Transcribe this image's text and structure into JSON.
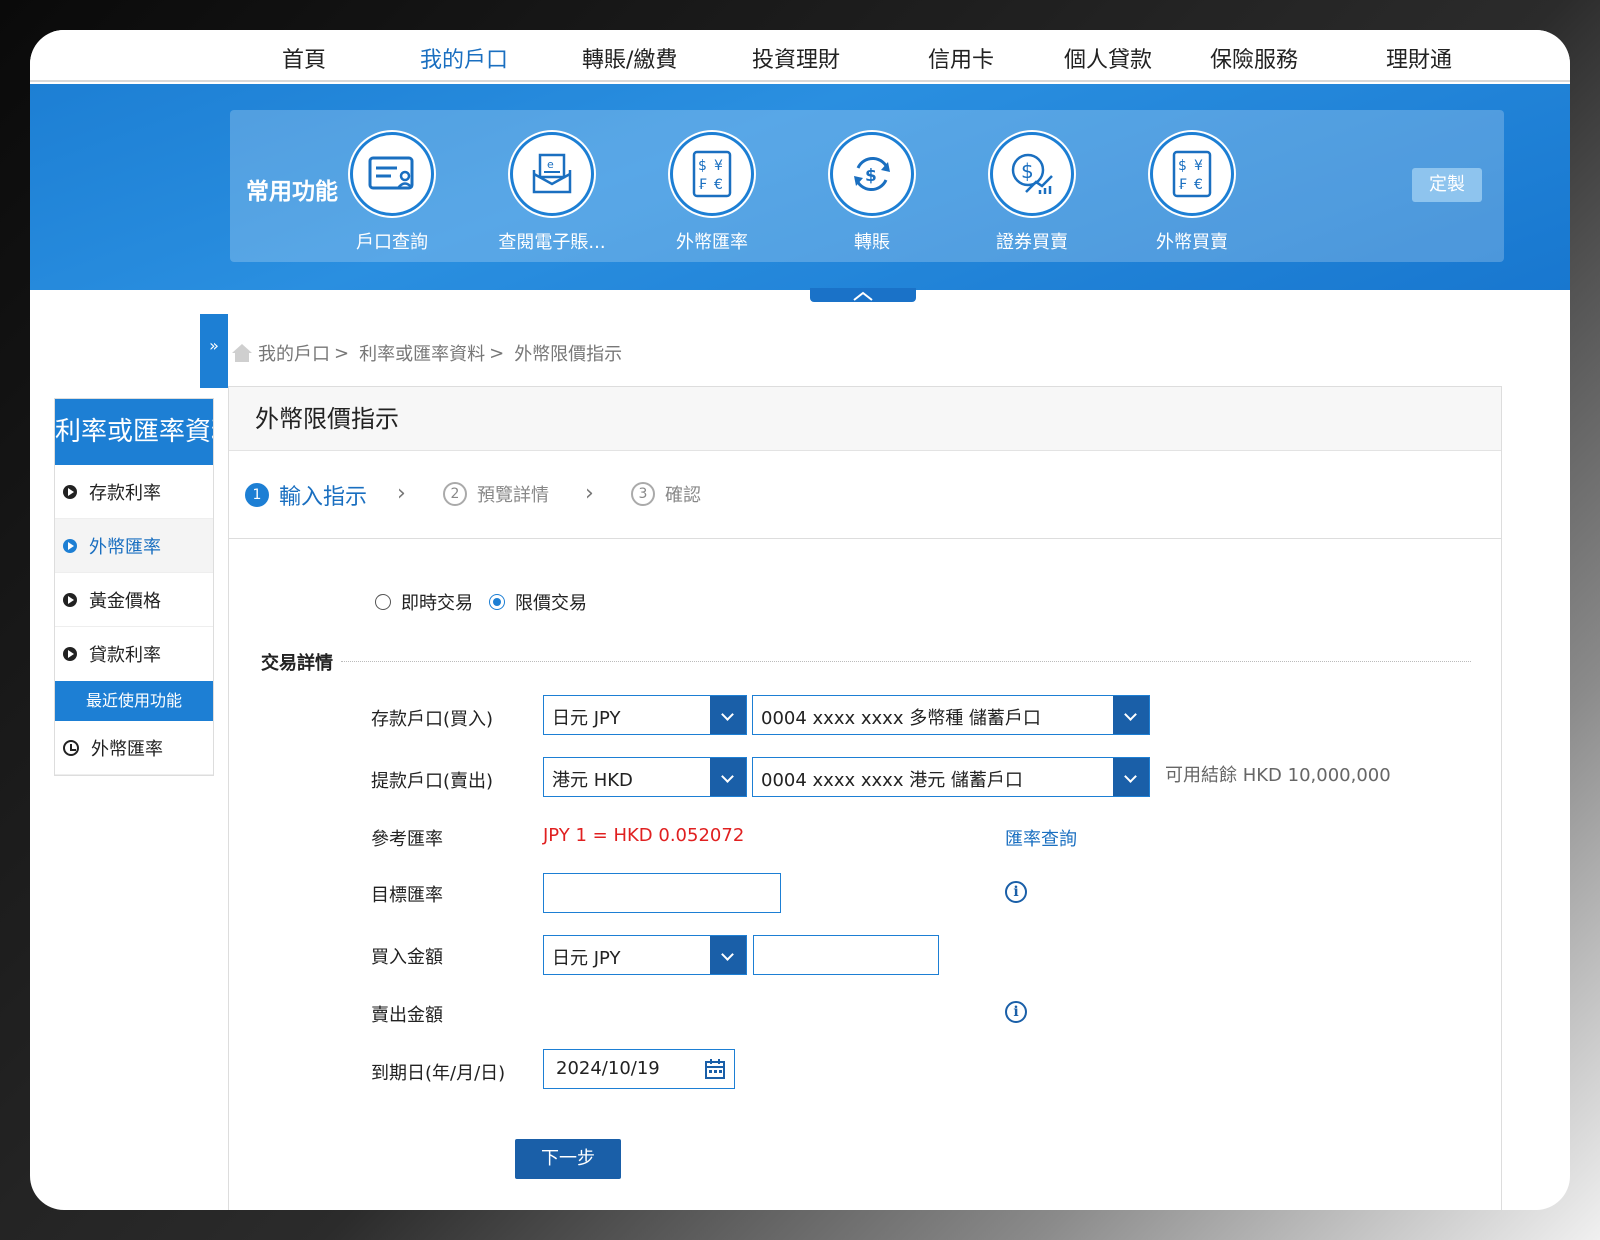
{
  "top_nav": [
    "首頁",
    "我的戶口",
    "轉賬/繳費",
    "投資理財",
    "信用卡",
    "個人貸款",
    "保險服務",
    "理財通"
  ],
  "quick_functions": {
    "title": "常用功能",
    "items": [
      "戶口查詢",
      "查閱電子賬...",
      "外幣匯率",
      "轉賬",
      "證券買賣",
      "外幣買賣"
    ],
    "customize_label": "定製"
  },
  "breadcrumb": [
    "我的戶口",
    "利率或匯率資料",
    "外幣限價指示"
  ],
  "left_menu": {
    "title": "利率或匯率資料",
    "items": [
      "存款利率",
      "外幣匯率",
      "黃金價格",
      "貸款利率"
    ],
    "recent_title": "最近使用功能",
    "recent_items": [
      "外幣匯率"
    ]
  },
  "page_title": "外幣限價指示",
  "steps": [
    {
      "num": "1",
      "label": "輸入指示"
    },
    {
      "num": "2",
      "label": "預覽詳情"
    },
    {
      "num": "3",
      "label": "確認"
    }
  ],
  "trade_type": {
    "options": [
      "即時交易",
      "限價交易"
    ],
    "selected": "限價交易"
  },
  "section_title": "交易詳情",
  "form": {
    "deposit_account_label": "存款戶口(買入)",
    "deposit_currency": "日元 JPY",
    "deposit_account": "0004 xxxx xxxx 多幣種 儲蓄戶口",
    "withdraw_account_label": "提款戶口(賣出)",
    "withdraw_currency": "港元 HKD",
    "withdraw_account": "0004 xxxx xxxx 港元 儲蓄戶口",
    "available_balance": "可用結餘 HKD 10,000,000",
    "ref_rate_label": "參考匯率",
    "ref_rate_value": "JPY 1 = HKD 0.052072",
    "rate_query_link": "匯率查詢",
    "target_rate_label": "目標匯率",
    "target_rate_value": "",
    "buy_amount_label": "買入金額",
    "buy_currency": "日元 JPY",
    "buy_amount_value": "",
    "sell_amount_label": "賣出金額",
    "expiry_label": "到期日(年/月/日)",
    "expiry_value": "2024/10/19",
    "next_button": "下一步"
  },
  "colors": {
    "primary": "#1d7fd4",
    "dark_blue": "#1a5fa8",
    "rate_red": "#e02020"
  }
}
